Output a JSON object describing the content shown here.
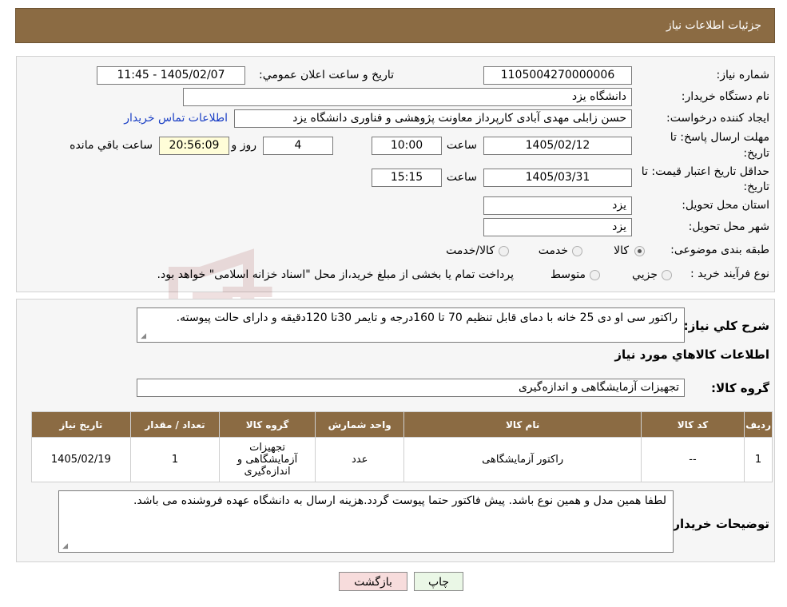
{
  "header": {
    "title": "جزئیات اطلاعات نیاز"
  },
  "watermark": {
    "text": "AriaTender.neT",
    "color": "#8b1a1a"
  },
  "form": {
    "need_number_label": "شماره نیاز:",
    "need_number": "1105004270000006",
    "announce_label": "تاریخ و ساعت اعلان عمومي:",
    "announce_value": "1405/02/07 - 11:45",
    "buyer_org_label": "نام دستگاه خريدار:",
    "buyer_org": "دانشگاه یزد",
    "requester_label": "ایجاد کننده درخواست:",
    "requester": "حسن زابلی مهدی آبادی کارپرداز معاونت پژوهشی و فناوری دانشگاه یزد",
    "contact_link": "اطلاعات تماس خريدار",
    "reply_deadline_label_1": "مهلت ارسال پاسخ: تا",
    "reply_deadline_label_2": "تاريخ:",
    "reply_date": "1405/02/12",
    "time_word": "ساعت",
    "reply_time": "10:00",
    "days_value": "4",
    "days_word": "روز و",
    "remaining_value": "20:56:09",
    "remaining_word": "ساعت باقي مانده",
    "price_validity_label_1": "حداقل تاريخ اعتبار قيمت: تا",
    "price_validity_label_2": "تاريخ:",
    "price_date": "1405/03/31",
    "price_time": "15:15",
    "province_label": "استان محل تحويل:",
    "province": "یزد",
    "city_label": "شهر محل تحويل:",
    "city": "یزد",
    "category_label": "طبقه بندی موضوعی:",
    "category_options": [
      "كالا",
      "خدمت",
      "كالا/خدمت"
    ],
    "category_selected": "كالا",
    "process_label": "نوع فرآیند خرید :",
    "process_options": [
      "جزيي",
      "متوسط"
    ],
    "process_note": "پرداخت تمام يا بخشی از مبلغ خريد،از محل \"اسناد خزانه اسلامی\" خواهد بود."
  },
  "details": {
    "general_desc_label": "شرح كلي نياز:",
    "general_desc": "راکتور سی او دی 25 خانه با دمای قابل تنظیم 70 تا 160درجه و تایمر 30تا 120دقیقه و دارای حالت پیوسته.",
    "items_info_title": "اطلاعات كالاهاي مورد نياز",
    "goods_group_label": "گروه كالا:",
    "goods_group": "تجهیزات آزمایشگاهی و اندازه‌گیری",
    "table": {
      "headers": [
        "رديف",
        "كد كالا",
        "نام كالا",
        "واحد شمارش",
        "گروه كالا",
        "تعداد / مقدار",
        "تاريخ نياز"
      ],
      "rows": [
        [
          "1",
          "--",
          "راکتور آزمایشگاهی",
          "عدد",
          "تجهیزات آزمایشگاهی و اندازه‌گیری",
          "1",
          "1405/02/19"
        ]
      ]
    },
    "buyer_notes_label": "توضيحات خريدار:",
    "buyer_notes": "لطفا همین مدل و همین نوع باشد. پیش فاکتور حتما پیوست گردد.هزینه ارسال به دانشگاه عهده فروشنده می باشد."
  },
  "buttons": {
    "print": "چاپ",
    "back": "بازگشت"
  },
  "colors": {
    "header_bg": "#8b6b43",
    "back_button_bg": "#f7dcdc",
    "print_button_bg": "#eaf7e6",
    "link": "#1a3fc5"
  }
}
